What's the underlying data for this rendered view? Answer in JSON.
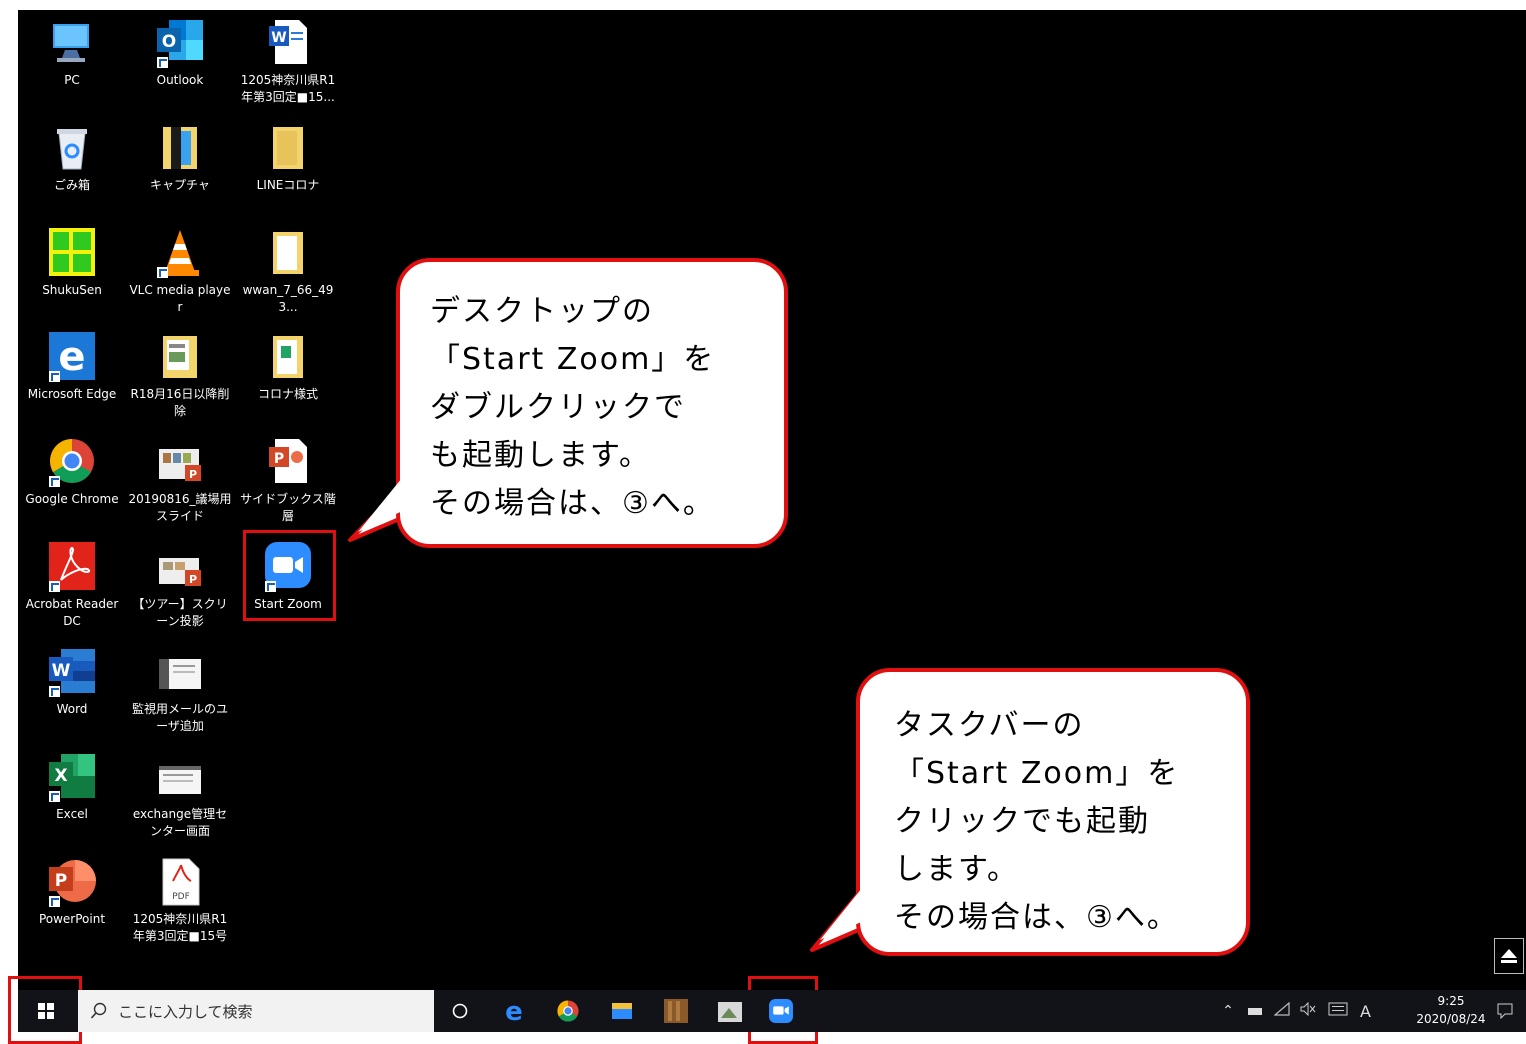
{
  "desktop_icons": [
    {
      "label": "PC",
      "icon": "pc-icon"
    },
    {
      "label": "Outlook",
      "icon": "outlook-icon"
    },
    {
      "label": "1205神奈川県R1年第3回定■15...",
      "icon": "word-doc-icon"
    },
    {
      "label": "ごみ箱",
      "icon": "recycle-bin-icon"
    },
    {
      "label": "キャプチャ",
      "icon": "folder-icon"
    },
    {
      "label": "LINEコロナ",
      "icon": "folder-icon"
    },
    {
      "label": "ShukuSen",
      "icon": "shukusen-icon"
    },
    {
      "label": "VLC media player",
      "icon": "vlc-icon"
    },
    {
      "label": "wwan_7_66_493...",
      "icon": "folder-icon"
    },
    {
      "label": "Microsoft Edge",
      "icon": "edge-icon"
    },
    {
      "label": "R18月16日以降削除",
      "icon": "folder-icon"
    },
    {
      "label": "コロナ様式",
      "icon": "folder-icon"
    },
    {
      "label": "Google Chrome",
      "icon": "chrome-icon"
    },
    {
      "label": "20190816_議場用スライド",
      "icon": "pptx-file-icon"
    },
    {
      "label": "サイドブックス階層",
      "icon": "powerpoint-file-icon"
    },
    {
      "label": "Acrobat Reader DC",
      "icon": "acrobat-icon"
    },
    {
      "label": "【ツアー】スクリーン投影",
      "icon": "pptx-file-icon"
    },
    {
      "label": "Start Zoom",
      "icon": "zoom-icon"
    },
    {
      "label": "Word",
      "icon": "word-icon"
    },
    {
      "label": "監視用メールのユーザ追加",
      "icon": "screenshot-file-icon"
    },
    {
      "label": "Excel",
      "icon": "excel-icon"
    },
    {
      "label": "exchange管理センター画面",
      "icon": "screenshot-file-icon"
    },
    {
      "label": "PowerPoint",
      "icon": "powerpoint-icon"
    },
    {
      "label": "1205神奈川県R1年第3回定■15号",
      "icon": "pdf-icon"
    }
  ],
  "callouts": {
    "desktop": "デスクトップの\n「Start Zoom」を\nダブルクリックで\nも起動します。\nその場合は、③へ。",
    "taskbar": "タスクバーの\n「Start Zoom」を\nクリックでも起動\nします。\nその場合は、③へ。"
  },
  "taskbar": {
    "search_placeholder": "ここに入力して検索",
    "pinned": [
      "task-view-icon",
      "edge-icon",
      "chrome-icon",
      "file-explorer-icon",
      "app-icon",
      "app-icon",
      "zoom-icon"
    ],
    "time": "9:25",
    "date": "2020/08/24",
    "ime": "A"
  },
  "colors": {
    "highlight": "#e01010",
    "desktop_bg": "#000000",
    "taskbar_bg": "#111318",
    "zoom_blue": "#2d8cff"
  }
}
